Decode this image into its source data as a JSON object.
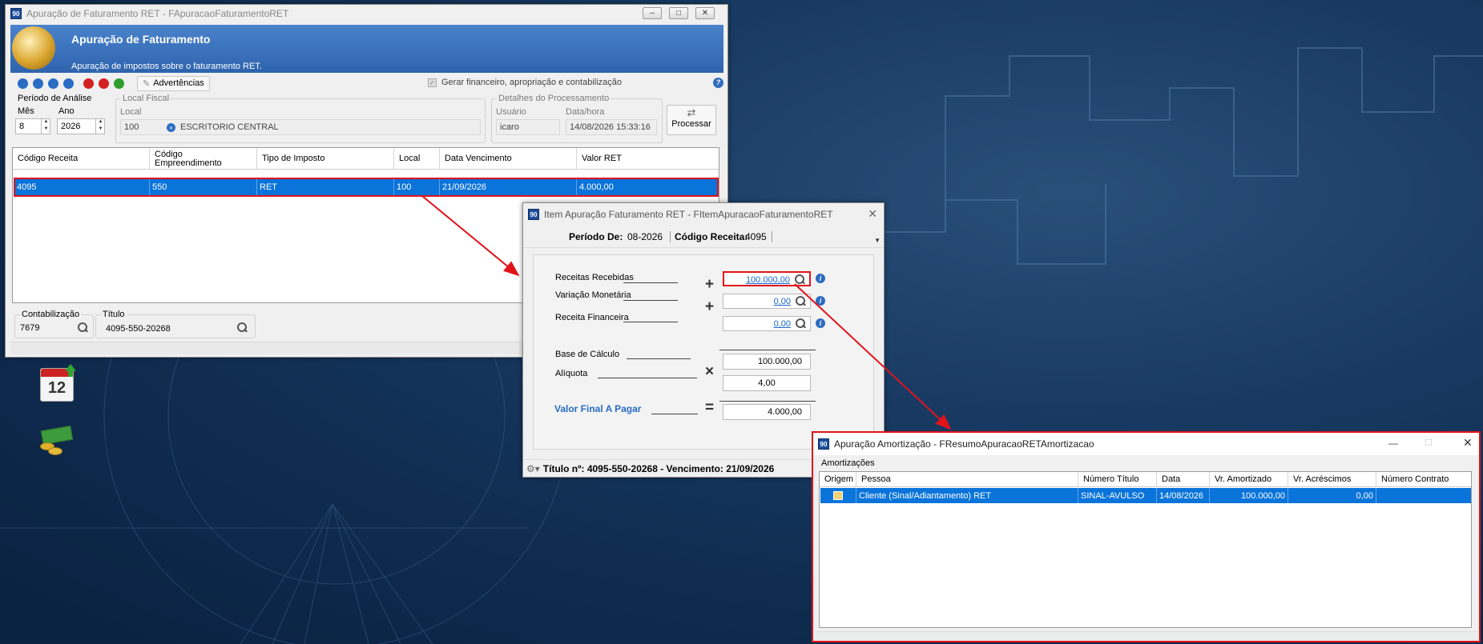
{
  "main": {
    "title": "Apuração de Faturamento RET - FApuracaoFaturamentoRET",
    "banner_title": "Apuração de Faturamento",
    "banner_subtitle": "Apuração de impostos sobre o faturamento RET.",
    "toolbar": {
      "advertencias": "Advertências",
      "gerar_label": "Gerar financeiro, apropriação e contabilização"
    },
    "periodo": {
      "group": "Período de Análise",
      "mes_label": "Mês",
      "mes": "8",
      "ano_label": "Ano",
      "ano": "2026"
    },
    "local_fiscal": {
      "group": "Local Fiscal",
      "local_label": "Local",
      "code": "100",
      "name": "ESCRITORIO CENTRAL"
    },
    "detalhes": {
      "group": "Detalhes do Processamento",
      "usuario_label": "Usuário",
      "usuario": "icaro",
      "datahora_label": "Data/hora",
      "datahora": "14/08/2026 15:33:16"
    },
    "processar": "Processar",
    "grid": {
      "headers": [
        "Código Receita",
        "Código Empreendimento",
        "Tipo de Imposto",
        "Local",
        "Data Vencimento",
        "Valor RET"
      ],
      "row": [
        "4095",
        "550",
        "RET",
        "100",
        "21/09/2026",
        "4.000,00"
      ]
    },
    "contabilizacao": {
      "label": "Contabilização",
      "value": "7679"
    },
    "titulo": {
      "label": "Título",
      "value": "4095-550-20268"
    }
  },
  "item": {
    "title": "Item Apuração Faturamento RET - FItemApuracaoFaturamentoRET",
    "periodo_label": "Período De:",
    "periodo": "08-2026",
    "codigo_label": "Código Receita:",
    "codigo": "4095",
    "receitas_recebidas": {
      "label": "Receitas Recebidas",
      "value": "100.000,00"
    },
    "variacao_monetaria": {
      "label": "Variação Monetária",
      "value": "0,00"
    },
    "receita_financeira": {
      "label": "Receita Financeira",
      "value": "0,00"
    },
    "base_calculo": {
      "label": "Base de Cálculo",
      "value": "100.000,00"
    },
    "aliquota": {
      "label": "Alíquota",
      "value": "4,00"
    },
    "valor_final": {
      "label": "Valor Final A Pagar",
      "value": "4.000,00"
    },
    "ops": {
      "plus": "+",
      "times": "×",
      "equals": "="
    },
    "footer": "Título nº: 4095-550-20268 - Vencimento: 21/09/2026"
  },
  "amort": {
    "title": "Apuração Amortização - FResumoApuracaoRETAmortizacao",
    "section": "Amortizações",
    "headers": [
      "Origem",
      "Pessoa",
      "Número Título",
      "Data",
      "Vr. Amortizado",
      "Vr. Acréscimos",
      "Número Contrato"
    ],
    "row": [
      "",
      "Cliente (Sinal/Adiantamento) RET",
      "SINAL-AVULSO",
      "14/08/2026",
      "100.000,00",
      "0,00",
      ""
    ]
  },
  "desktop": {
    "calendar_number": "12"
  },
  "colors": {
    "selection": "#0a74da",
    "highlight": "#e0131b",
    "banner": "#3b73c0",
    "link": "#1a66cc"
  }
}
